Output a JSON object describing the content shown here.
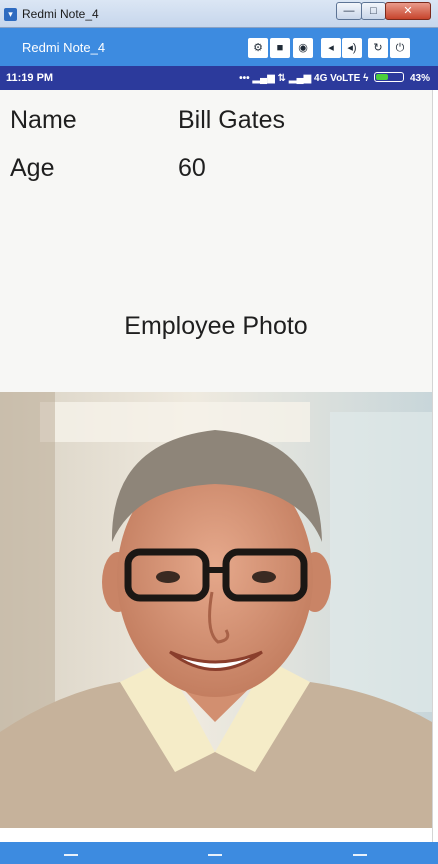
{
  "window": {
    "title": "Redmi Note_4",
    "minimize_glyph": "—",
    "maximize_glyph": "□",
    "close_glyph": "✕"
  },
  "emulator": {
    "device_name": "Redmi Note_4",
    "buttons": [
      {
        "name": "settings-icon",
        "glyph": "⚙"
      },
      {
        "name": "video-record-icon",
        "glyph": "■"
      },
      {
        "name": "camera-icon",
        "glyph": "◉"
      },
      {
        "name": "volume-down-icon",
        "glyph": "◂"
      },
      {
        "name": "volume-up-icon",
        "glyph": "◂)"
      },
      {
        "name": "rotate-icon",
        "glyph": "↻"
      },
      {
        "name": "power-icon",
        "glyph": "⏻"
      }
    ]
  },
  "status_bar": {
    "time": "11:19 PM",
    "network": "4G VoLTE",
    "battery_percent": "43%",
    "battery_level": 0.43
  },
  "employee": {
    "name_label": "Name",
    "name_value": "Bill Gates",
    "age_label": "Age",
    "age_value": "60"
  },
  "photo_section": {
    "heading": "Employee Photo"
  }
}
